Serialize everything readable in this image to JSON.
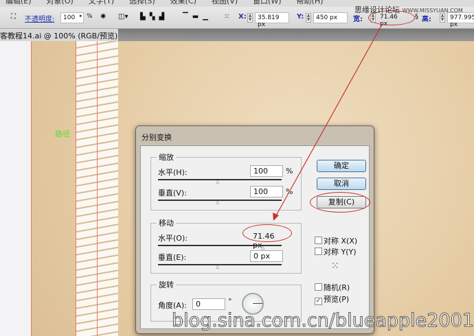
{
  "menu": [
    "编辑(E)",
    "对象(O)",
    "文字(T)",
    "选择(S)",
    "效果(C)",
    "视图(V)",
    "窗口(W)",
    "帮助(H)"
  ],
  "toolbar": {
    "opacity_label": "不透明度:",
    "opacity_value": "100",
    "percent": "%",
    "x_label": "X:",
    "x_value": "35.819 px",
    "y_label": "Y:",
    "y_value": "450 px",
    "w_label": "宽:",
    "w_value": "71.46 px",
    "h_label": "高:",
    "h_value": "977.995 px"
  },
  "tab": {
    "title": "客教程14.ai @ 100% (RGB/预览)",
    "close": "✕"
  },
  "canvas": {
    "path_label": "路径"
  },
  "dialog": {
    "title": "分别变换",
    "scale": {
      "legend": "缩放",
      "h_label": "水平(H):",
      "h_value": "100",
      "v_label": "垂直(V):",
      "v_value": "100",
      "unit": "%"
    },
    "move": {
      "legend": "移动",
      "h_label": "水平(O):",
      "h_value": "71.46 px",
      "v_label": "垂直(E):",
      "v_value": "0 px"
    },
    "rotate": {
      "legend": "旋转",
      "angle_label": "角度(A):",
      "angle_value": "0",
      "degree": "°"
    },
    "buttons": {
      "ok": "确定",
      "cancel": "取消",
      "copy": "复制(C)"
    },
    "checks": {
      "reflect_x": "对称 X(X)",
      "reflect_y": "对称 Y(Y)",
      "random": "随机(R)",
      "preview": "预览(P)",
      "preview_checked": true
    }
  },
  "watermarks": {
    "top": "思缘设计论坛",
    "top_url": "WWW.MISSYUAN.COM",
    "bottom": "blog.sina.com.cn/blueapple2001"
  },
  "colors": {
    "annotation": "#c8332b",
    "accent": "#2233aa"
  }
}
